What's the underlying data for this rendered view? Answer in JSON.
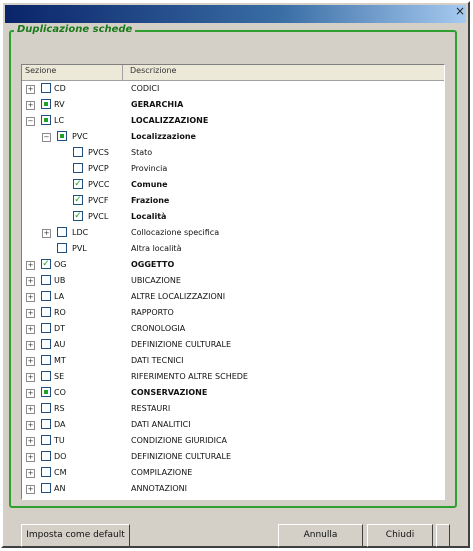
{
  "window": {
    "close_glyph": "×"
  },
  "group": {
    "title": "Duplicazione schede"
  },
  "columns": {
    "section": "Sezione",
    "description": "Descrizione"
  },
  "rows": [
    {
      "code": "CD",
      "desc": "CODICI",
      "level": 0,
      "expander": "+",
      "check": "none",
      "bold": false
    },
    {
      "code": "RV",
      "desc": "GERARCHIA",
      "level": 0,
      "expander": "+",
      "check": "square",
      "bold": true
    },
    {
      "code": "LC",
      "desc": "LOCALIZZAZIONE",
      "level": 0,
      "expander": "-",
      "check": "square",
      "bold": true
    },
    {
      "code": "PVC",
      "desc": "Localizzazione",
      "level": 1,
      "expander": "-",
      "check": "square",
      "bold": true
    },
    {
      "code": "PVCS",
      "desc": "Stato",
      "level": 2,
      "expander": "",
      "check": "none",
      "bold": false
    },
    {
      "code": "PVCP",
      "desc": "Provincia",
      "level": 2,
      "expander": "",
      "check": "none",
      "bold": false
    },
    {
      "code": "PVCC",
      "desc": "Comune",
      "level": 2,
      "expander": "",
      "check": "tick",
      "bold": true
    },
    {
      "code": "PVCF",
      "desc": "Frazione",
      "level": 2,
      "expander": "",
      "check": "tick",
      "bold": true
    },
    {
      "code": "PVCL",
      "desc": "Località",
      "level": 2,
      "expander": "",
      "check": "tick",
      "bold": true
    },
    {
      "code": "LDC",
      "desc": "Collocazione specifica",
      "level": 1,
      "expander": "+",
      "check": "none",
      "bold": false
    },
    {
      "code": "PVL",
      "desc": "Altra località",
      "level": 1,
      "expander": "",
      "check": "none",
      "bold": false
    },
    {
      "code": "OG",
      "desc": "OGGETTO",
      "level": 0,
      "expander": "+",
      "check": "tick",
      "bold": true
    },
    {
      "code": "UB",
      "desc": "UBICAZIONE",
      "level": 0,
      "expander": "+",
      "check": "none",
      "bold": false
    },
    {
      "code": "LA",
      "desc": "ALTRE LOCALIZZAZIONI",
      "level": 0,
      "expander": "+",
      "check": "none",
      "bold": false
    },
    {
      "code": "RO",
      "desc": "RAPPORTO",
      "level": 0,
      "expander": "+",
      "check": "none",
      "bold": false
    },
    {
      "code": "DT",
      "desc": "CRONOLOGIA",
      "level": 0,
      "expander": "+",
      "check": "none",
      "bold": false
    },
    {
      "code": "AU",
      "desc": "DEFINIZIONE CULTURALE",
      "level": 0,
      "expander": "+",
      "check": "none",
      "bold": false
    },
    {
      "code": "MT",
      "desc": "DATI TECNICI",
      "level": 0,
      "expander": "+",
      "check": "none",
      "bold": false
    },
    {
      "code": "SE",
      "desc": "RIFERIMENTO ALTRE SCHEDE",
      "level": 0,
      "expander": "+",
      "check": "none",
      "bold": false
    },
    {
      "code": "CO",
      "desc": "CONSERVAZIONE",
      "level": 0,
      "expander": "+",
      "check": "square",
      "bold": true
    },
    {
      "code": "RS",
      "desc": "RESTAURI",
      "level": 0,
      "expander": "+",
      "check": "none",
      "bold": false
    },
    {
      "code": "DA",
      "desc": "DATI ANALITICI",
      "level": 0,
      "expander": "+",
      "check": "none",
      "bold": false
    },
    {
      "code": "TU",
      "desc": "CONDIZIONE GIURIDICA",
      "level": 0,
      "expander": "+",
      "check": "none",
      "bold": false
    },
    {
      "code": "DO",
      "desc": "DEFINIZIONE CULTURALE",
      "level": 0,
      "expander": "+",
      "check": "none",
      "bold": false
    },
    {
      "code": "CM",
      "desc": "COMPILAZIONE",
      "level": 0,
      "expander": "+",
      "check": "none",
      "bold": false
    },
    {
      "code": "AN",
      "desc": "ANNOTAZIONI",
      "level": 0,
      "expander": "+",
      "check": "none",
      "bold": false
    }
  ],
  "buttons": {
    "default": "Imposta come default",
    "cancel": "Annulla",
    "close": "Chiudi"
  }
}
